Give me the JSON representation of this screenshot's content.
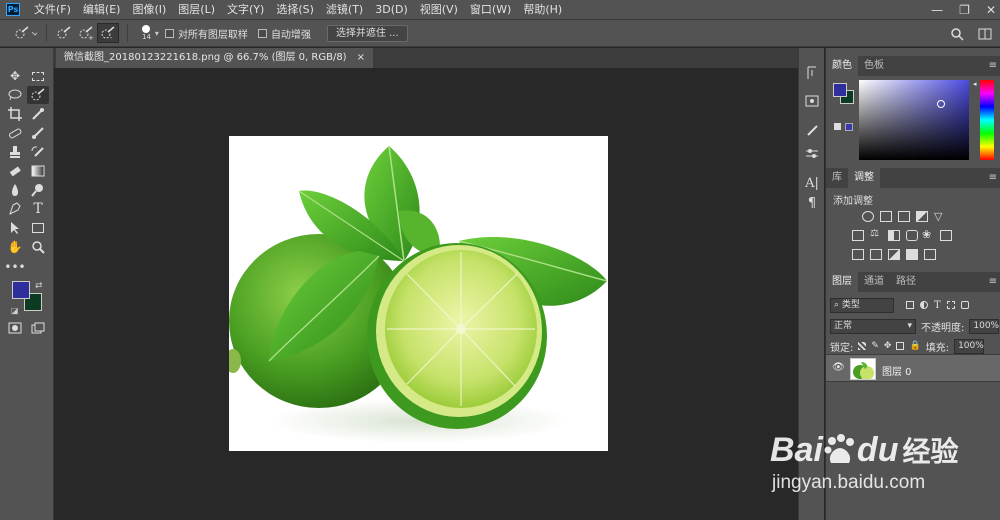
{
  "menubar": {
    "app_icon": "Ps",
    "items": [
      "文件(F)",
      "编辑(E)",
      "图像(I)",
      "图层(L)",
      "文字(Y)",
      "选择(S)",
      "滤镜(T)",
      "3D(D)",
      "视图(V)",
      "窗口(W)",
      "帮助(H)"
    ],
    "window_controls": [
      "—",
      "❐",
      "✕"
    ]
  },
  "options": {
    "brush_size": "14",
    "sample_all_layers": "对所有图层取样",
    "auto_enhance": "自动增强",
    "refine_button": "选择并遮住 ..."
  },
  "document": {
    "tab_title": "微信截图_20180123221618.png @ 66.7% (图层 0, RGB/8)",
    "tab_close": "×"
  },
  "color_panel": {
    "tabs": [
      "颜色",
      "色板"
    ],
    "foreground": "#2e2e9c",
    "background": "#0d3b22",
    "hue_accent": "#4a4ae0"
  },
  "adjust_panel": {
    "tabs": [
      "库",
      "调整"
    ],
    "title": "添加调整"
  },
  "layers_panel": {
    "tabs": [
      "图层",
      "通道",
      "路径"
    ],
    "filter_kind": "类型",
    "blend_mode": "正常",
    "opacity_label": "不透明度:",
    "opacity_value": "100%",
    "lock_label": "锁定:",
    "fill_label": "填充:",
    "fill_value": "100%",
    "layers": [
      {
        "name": "图层 0"
      }
    ]
  },
  "watermark": {
    "brand": "Bai",
    "brand_suffix": "du",
    "brand_cn": "经验",
    "url": "jingyan.baidu.com"
  }
}
